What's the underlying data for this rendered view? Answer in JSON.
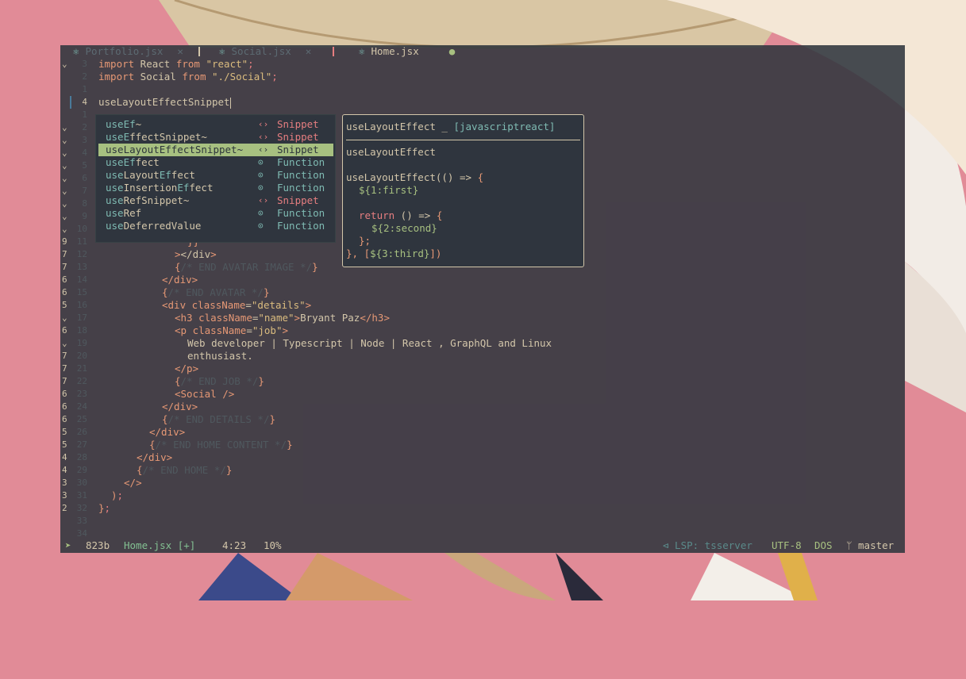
{
  "tabs": [
    {
      "name": "Portfolio.jsx",
      "close": "✕",
      "active": false
    },
    {
      "name": "Social.jsx",
      "close": "✕",
      "active": false
    },
    {
      "name": "Home.jsx",
      "modified": "●",
      "active": true
    }
  ],
  "gutter": [
    {
      "fold": "⌄",
      "num": "3"
    },
    {
      "fold": "",
      "num": "2"
    },
    {
      "fold": "",
      "num": "1"
    },
    {
      "fold": "",
      "num": "4",
      "current": true
    },
    {
      "fold": "",
      "num": "1"
    },
    {
      "fold": "⌄",
      "num": "2"
    },
    {
      "fold": "⌄",
      "num": "3"
    },
    {
      "fold": "⌄",
      "num": "4"
    },
    {
      "fold": "⌄",
      "num": "5"
    },
    {
      "fold": "⌄",
      "num": "6"
    },
    {
      "fold": "⌄",
      "num": "7"
    },
    {
      "fold": "⌄",
      "num": "8"
    },
    {
      "fold": "⌄",
      "num": "9"
    },
    {
      "fold": "⌄",
      "num": "10"
    },
    {
      "fold": "9",
      "num": "11"
    },
    {
      "fold": "7",
      "num": "12"
    },
    {
      "fold": "7",
      "num": "13"
    },
    {
      "fold": "6",
      "num": "14"
    },
    {
      "fold": "6",
      "num": "15"
    },
    {
      "fold": "5",
      "num": "16"
    },
    {
      "fold": "⌄",
      "num": "17"
    },
    {
      "fold": "6",
      "num": "18"
    },
    {
      "fold": "⌄",
      "num": "19"
    },
    {
      "fold": "7",
      "num": "20"
    },
    {
      "fold": "7",
      "num": "21"
    },
    {
      "fold": "7",
      "num": "22"
    },
    {
      "fold": "6",
      "num": "23"
    },
    {
      "fold": "6",
      "num": "24"
    },
    {
      "fold": "6",
      "num": "25"
    },
    {
      "fold": "5",
      "num": "26"
    },
    {
      "fold": "5",
      "num": "27"
    },
    {
      "fold": "4",
      "num": "28"
    },
    {
      "fold": "4",
      "num": "29"
    },
    {
      "fold": "3",
      "num": "30"
    },
    {
      "fold": "3",
      "num": "31"
    },
    {
      "fold": "2",
      "num": "32"
    },
    {
      "fold": "",
      "num": "33"
    },
    {
      "fold": "",
      "num": "34"
    }
  ],
  "code": {
    "l1": {
      "kw": "import",
      "name": " React ",
      "from": "from",
      "str": "\"react\"",
      "semi": ";"
    },
    "l2": {
      "kw": "import",
      "name": " Social ",
      "from": "from",
      "str": "\"./Social\"",
      "semi": ";"
    },
    "l4": {
      "text": "useLayoutEffectSnippet"
    },
    "l16": {
      "text": "}}"
    },
    "l17": {
      "a": ">",
      "b": "</div",
      "c": ">"
    },
    "l18": {
      "a": "{",
      "b": "/* END AVATAR IMAGE */",
      "c": "}"
    },
    "l19": {
      "a": "</div",
      "b": ">"
    },
    "l20": {
      "a": "{",
      "b": "/* END AVATAR */",
      "c": "}"
    },
    "l21": {
      "a": "<div ",
      "attr": "className",
      "eq": "=",
      "str": "\"details\"",
      "c": ">"
    },
    "l22": {
      "a": "<h3 ",
      "attr": "className",
      "eq": "=",
      "str": "\"name\"",
      "b": ">",
      "txt": "Bryant Paz",
      "c": "</h3",
      "d": ">"
    },
    "l23": {
      "a": "<p ",
      "attr": "className",
      "eq": "=",
      "str": "\"job\"",
      "c": ">"
    },
    "l24": {
      "text": "Web developer | Typescript | Node | React , GraphQL and Linux"
    },
    "l25": {
      "text": "enthusiast."
    },
    "l26": {
      "a": "</p",
      "b": ">"
    },
    "l27": {
      "a": "{",
      "b": "/* END JOB */",
      "c": "}"
    },
    "l28": {
      "a": "<Social ",
      "b": "/>"
    },
    "l29": {
      "a": "</div",
      "b": ">"
    },
    "l30": {
      "a": "{",
      "b": "/* END DETAILS */",
      "c": "}"
    },
    "l31": {
      "a": "</div",
      "b": ">"
    },
    "l32": {
      "a": "{",
      "b": "/* END HOME CONTENT */",
      "c": "}"
    },
    "l33": {
      "a": "</div",
      "b": ">"
    },
    "l34": {
      "a": "{",
      "b": "/* END HOME */",
      "c": "}"
    },
    "l35": {
      "a": "</",
      "b": ">"
    },
    "l36": {
      "a": ")",
      "b": ";"
    },
    "l37": {
      "a": "}",
      "b": ";"
    }
  },
  "completion": {
    "icons": {
      "snippet": "‹›",
      "function": "⊙"
    },
    "items": [
      {
        "match": "useEf",
        "rest": "~",
        "kind": "Snippet",
        "type": "snippet",
        "selected": false
      },
      {
        "match": "useE",
        "rest": "ffectSnippet~",
        "kind": "Snippet",
        "type": "snippet",
        "selected": false
      },
      {
        "match": "useLayoutEffectSnippet~",
        "rest": "",
        "kind": "Snippet",
        "type": "snippet",
        "selected": true
      },
      {
        "match": "useEf",
        "rest": "fect",
        "kind": "Function",
        "type": "function",
        "selected": false
      },
      {
        "match": "use",
        "rest": "Layout",
        "match2": "Ef",
        "rest2": "fect",
        "kind": "Function",
        "type": "function",
        "selected": false
      },
      {
        "match": "use",
        "rest": "Insertion",
        "match2": "Ef",
        "rest2": "fect",
        "kind": "Function",
        "type": "function",
        "selected": false
      },
      {
        "match": "use",
        "rest": "RefSnippet~",
        "kind": "Snippet",
        "type": "snippet",
        "selected": false
      },
      {
        "match": "use",
        "rest": "Ref",
        "kind": "Function",
        "type": "function",
        "selected": false
      },
      {
        "match": "use",
        "rest": "DeferredValue",
        "kind": "Function",
        "type": "function",
        "selected": false
      }
    ]
  },
  "doc": {
    "title": "useLayoutEffect _ ",
    "lang": "[javascriptreact]",
    "name": "useLayoutEffect",
    "l1a": "useLayoutEffect(() => ",
    "l1b": "{",
    "l2": "${1:first}",
    "l3a": "return",
    "l3b": " () => ",
    "l3c": "{",
    "l4": "${2:second}",
    "l5": "};",
    "l6a": "}, [",
    "l6b": "${3:third}",
    "l6c": "])"
  },
  "status": {
    "mode": "➤",
    "size": "823b",
    "file": "Home.jsx [+]",
    "pos": "4:23",
    "pct": "10%",
    "lsp": "⊲ LSP: tsserver",
    "enc": "UTF-8",
    "ff": "DOS",
    "branch": "ᛘ master"
  }
}
